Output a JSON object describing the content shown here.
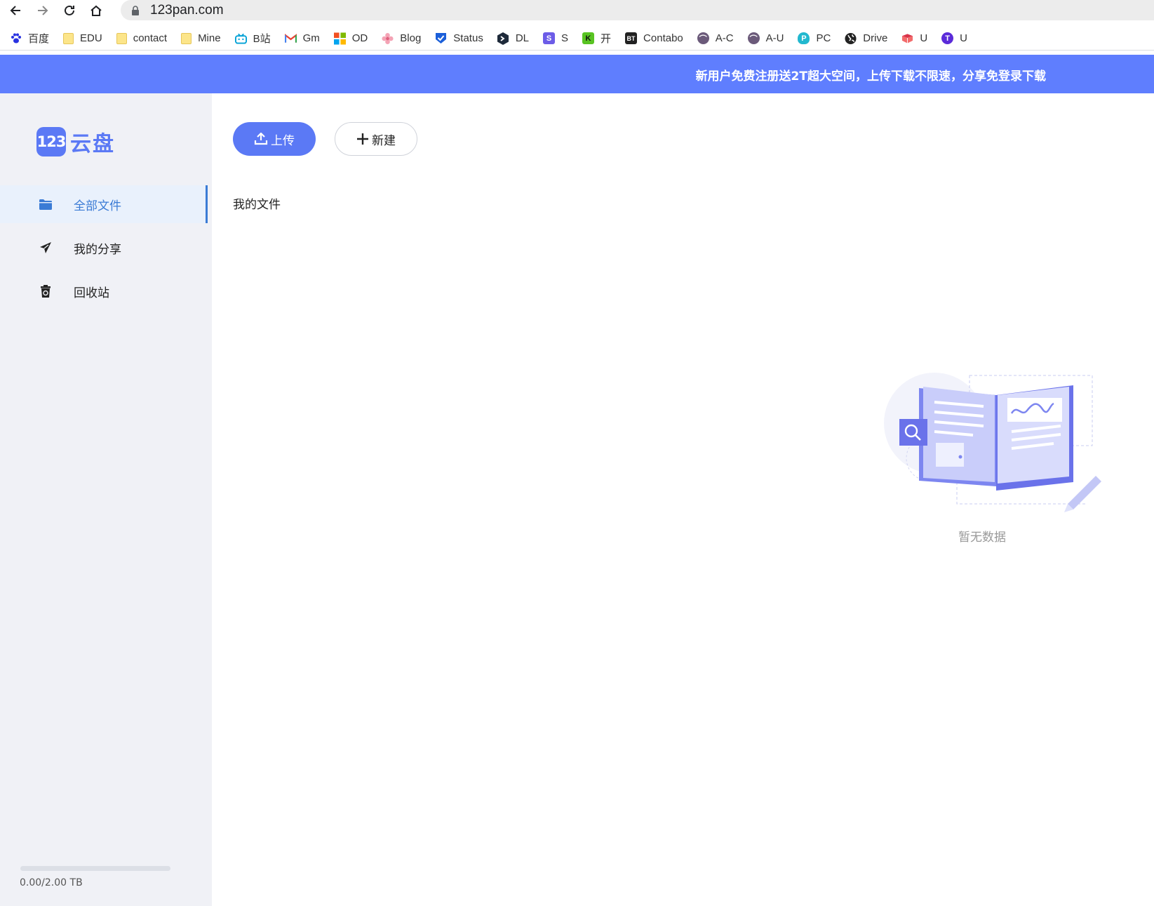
{
  "browser": {
    "url": "123pan.com",
    "bookmarks": [
      {
        "label": "百度",
        "icon": "baidu-paw-icon"
      },
      {
        "label": "EDU",
        "icon": "folder-icon"
      },
      {
        "label": "contact",
        "icon": "folder-icon"
      },
      {
        "label": "Mine",
        "icon": "folder-icon"
      },
      {
        "label": "B站",
        "icon": "bilibili-icon"
      },
      {
        "label": "Gm",
        "icon": "gmail-icon"
      },
      {
        "label": "OD",
        "icon": "microsoft-icon"
      },
      {
        "label": "Blog",
        "icon": "flower-icon"
      },
      {
        "label": "Status",
        "icon": "status-check-icon"
      },
      {
        "label": "DL",
        "icon": "dl-icon"
      },
      {
        "label": "S",
        "icon": "s-icon"
      },
      {
        "label": "开",
        "icon": "k-icon"
      },
      {
        "label": "Contabo",
        "icon": "bt-icon"
      },
      {
        "label": "A-C",
        "icon": "tooth-icon"
      },
      {
        "label": "A-U",
        "icon": "tooth-icon"
      },
      {
        "label": "PC",
        "icon": "p-cloud-icon"
      },
      {
        "label": "Drive",
        "icon": "globe-icon"
      },
      {
        "label": "U",
        "icon": "book-icon"
      },
      {
        "label": "U",
        "icon": "t-circle-icon"
      }
    ]
  },
  "banner": {
    "text": "新用户免费注册送2T超大空间，上传下载不限速，分享免登录下载"
  },
  "logo": {
    "mark": "123",
    "text": "云盘"
  },
  "sidebar": {
    "items": [
      {
        "label": "全部文件",
        "icon": "folder-icon",
        "active": true
      },
      {
        "label": "我的分享",
        "icon": "send-icon",
        "active": false
      },
      {
        "label": "回收站",
        "icon": "recycle-bin-icon",
        "active": false
      }
    ],
    "quota": {
      "used_fraction": 0.0,
      "text": "0.00/2.00 TB"
    }
  },
  "toolbar": {
    "upload_label": "上传",
    "new_label": "新建"
  },
  "breadcrumb": {
    "current": "我的文件"
  },
  "empty_state": {
    "text": "暂无数据"
  },
  "colors": {
    "accent": "#5b79f5",
    "banner": "#5f7efe",
    "active_text": "#3a7bd5",
    "sidebar_bg": "#f0f1f6"
  }
}
